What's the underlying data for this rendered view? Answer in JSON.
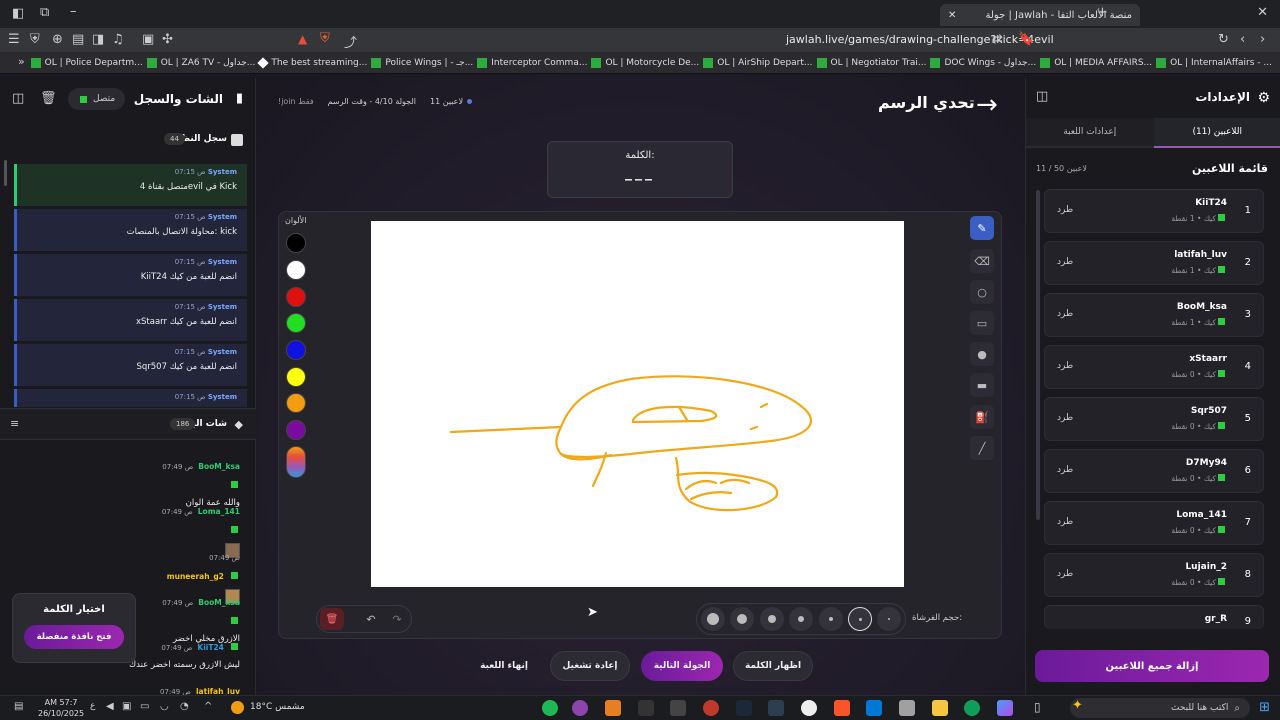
{
  "browser": {
    "tab_title": "جولة | Jawlah - منصة الألعاب التفا",
    "url": "jawlah.live/games/drawing-challenge?kick=4evil",
    "bookmarks": [
      "OL | InternalAffairs - ...",
      "OL | MEDIA AFFAIRS...",
      "DOC Wings - جداول...",
      "OL | Negotiator Trai...",
      "OL | AirShip Depart...",
      "OL | Motorcycle De...",
      "Interceptor Comma...",
      "Police Wings | - جـ...",
      "The best streaming...",
      "OL | ZA6 TV - جداول...",
      "OL | Police Departm..."
    ]
  },
  "settings": {
    "title": "الإعدادات",
    "tabs": [
      "اللاعبين (11)",
      "إعدادات اللعبة"
    ],
    "list_title": "قائمة اللاعبين",
    "list_count": "11 / 50 لاعبين",
    "kick_label": "طرد",
    "players": [
      {
        "rank": "1",
        "name": "KiiT24",
        "meta": "كيك • 1 نقطة"
      },
      {
        "rank": "2",
        "name": "latifah_luv",
        "meta": "كيك • 1 نقطة"
      },
      {
        "rank": "3",
        "name": "BooM_ksa",
        "meta": "كيك • 1 نقطة"
      },
      {
        "rank": "4",
        "name": "xStaarr",
        "meta": "كيك • 0 نقطة"
      },
      {
        "rank": "5",
        "name": "Sqr507",
        "meta": "كيك • 0 نقطة"
      },
      {
        "rank": "6",
        "name": "D7My94",
        "meta": "كيك • 0 نقطة"
      },
      {
        "rank": "7",
        "name": "Loma_141",
        "meta": "كيك • 0 نقطة"
      },
      {
        "rank": "8",
        "name": "Lujain_2",
        "meta": "كيك • 0 نقطة"
      },
      {
        "rank": "9",
        "name": "gr_R",
        "meta": ""
      }
    ],
    "remove_all": "إزالة جميع اللاعبين"
  },
  "chat": {
    "title": "الشات والسجل",
    "status": "متصل",
    "log_title": "سجل النظام",
    "log_count": "44",
    "log": [
      {
        "user": "System",
        "time": "07:15 ص",
        "text": "متصل بقناة 4evil في Kick"
      },
      {
        "user": "System",
        "time": "07:15 ص",
        "text": "محاولة الاتصال بالمنصات: kick"
      },
      {
        "user": "System",
        "time": "07:15 ص",
        "text": "KiiT24 انضم للعبة من كيك"
      },
      {
        "user": "System",
        "time": "07:15 ص",
        "text": "xStaarr انضم للعبة من كيك"
      },
      {
        "user": "System",
        "time": "07:15 ص",
        "text": "Sqr507 انضم للعبة من كيك"
      },
      {
        "user": "System",
        "time": "07:15 ص",
        "text": ""
      }
    ],
    "live_title": "شات البث",
    "live_count": "186",
    "messages": [
      {
        "user": "BooM_ksa",
        "time": "07:49 ص",
        "text": "والله عمة الوان",
        "color": "#2ecc71"
      },
      {
        "user": "Loma_141",
        "time": "07:49 ص",
        "text": "",
        "color": "#2ecc71"
      },
      {
        "user": "muneerah_g2",
        "time": "07:49 ص",
        "text": "",
        "color": "#f1c40f"
      },
      {
        "user": "BooM_ksa",
        "time": "07:49 ص",
        "text": "الازرق مخلي اخضر",
        "color": "#2ecc71"
      },
      {
        "user": "KiiT24",
        "time": "07:49 ص",
        "text": "ليش الازرق رسمته اخضر عندك",
        "color": "#3498db"
      },
      {
        "user": "latifah_luv",
        "time": "07:49 ص",
        "text": "",
        "color": "#f1c40f"
      }
    ],
    "pick_word_title": "اختيار الكلمة",
    "pick_word_button": "فتح نافذة منفصلة"
  },
  "game": {
    "title": "تحدي الرسم",
    "players_count": "11 لاعبين",
    "round": "الجولة 4/10 - وقت الرسم",
    "join_hint": "!join فقط",
    "word_label": "الكلمة:",
    "word_mask": "___",
    "colors_label": "الألوان",
    "colors": [
      "#000000",
      "#ffffff",
      "#e01010",
      "#22dd22",
      "#1010e0",
      "#ffff10",
      "#f39c12",
      "#7a0aa0"
    ],
    "brush_size_label": "حجم الفرشاة:",
    "buttons": {
      "show_word": "اظهار الكلمة",
      "next_round": "الجولة التالية",
      "restart": "إعادة تشغيل",
      "end_game": "إنهاء اللعبة"
    }
  },
  "taskbar": {
    "search_placeholder": "اكتب هنا للبحث",
    "weather": "18°C مشمس",
    "time": "AM 57:7",
    "date": "26/10/2025"
  }
}
